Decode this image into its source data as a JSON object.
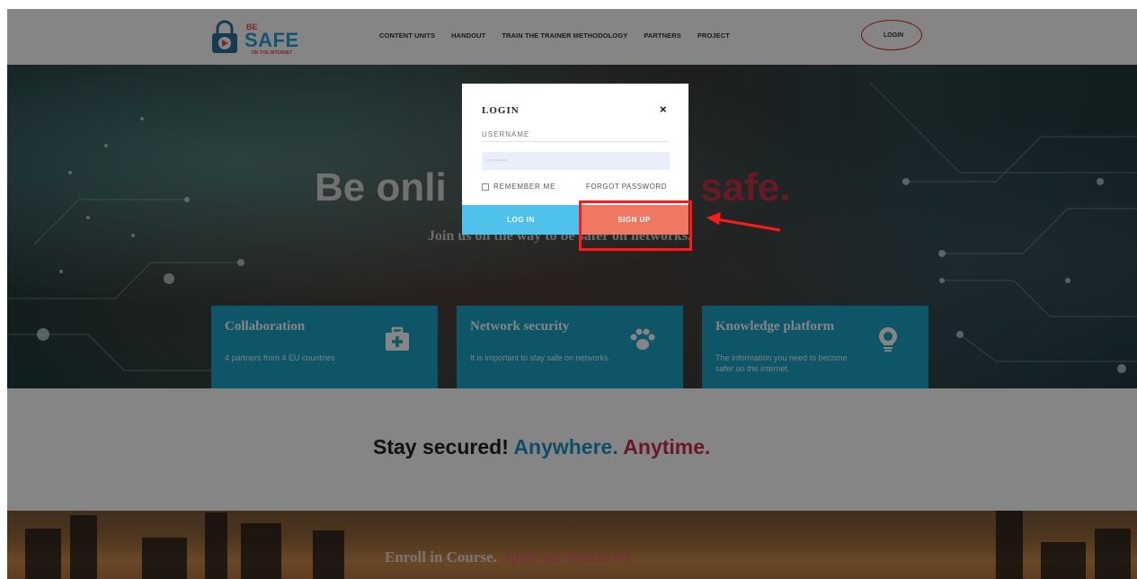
{
  "nav": {
    "logo_be": "BE",
    "logo_safe": "SAFE",
    "logo_tagline": "ON THE INTERNET",
    "links": [
      "CONTENT UNITS",
      "HANDOUT",
      "TRAIN THE TRAINER METHODOLOGY",
      "PARTNERS",
      "PROJECT"
    ],
    "login": "LOGIN"
  },
  "hero": {
    "title_part1": "Be onli",
    "title_part2": "Be safe.",
    "subtitle": "Join us on the way to be safer on networks."
  },
  "cards": [
    {
      "title": "Collaboration",
      "text": "4 partners from 4 EU countries",
      "icon": "first-aid-icon"
    },
    {
      "title": "Network security",
      "text": "It is important to stay safe on networks.",
      "icon": "paw-icon"
    },
    {
      "title": "Knowledge platform",
      "text": "The information you need to become safer on the internet.",
      "icon": "lightbulb-icon"
    }
  ],
  "tagline": {
    "part1": "Stay secured!",
    "part2": "Anywhere.",
    "part3": "Anytime."
  },
  "enroll": {
    "part1": "Enroll in Course.",
    "part2": "Apply for instructor."
  },
  "modal": {
    "title": "LOGIN",
    "close": "×",
    "username_placeholder": "USERNAME",
    "password_value": "·········",
    "remember_label": "REMEMBER ME",
    "forgot_label": "FORGOT PASSWORD",
    "login_button": "LOG IN",
    "signup_button": "SIGN UP"
  },
  "colors": {
    "accent_blue": "#4ec1ec",
    "signup_orange": "#ee7862",
    "card_blue": "#1ba3c6",
    "highlight_red": "#ff1a1a"
  }
}
